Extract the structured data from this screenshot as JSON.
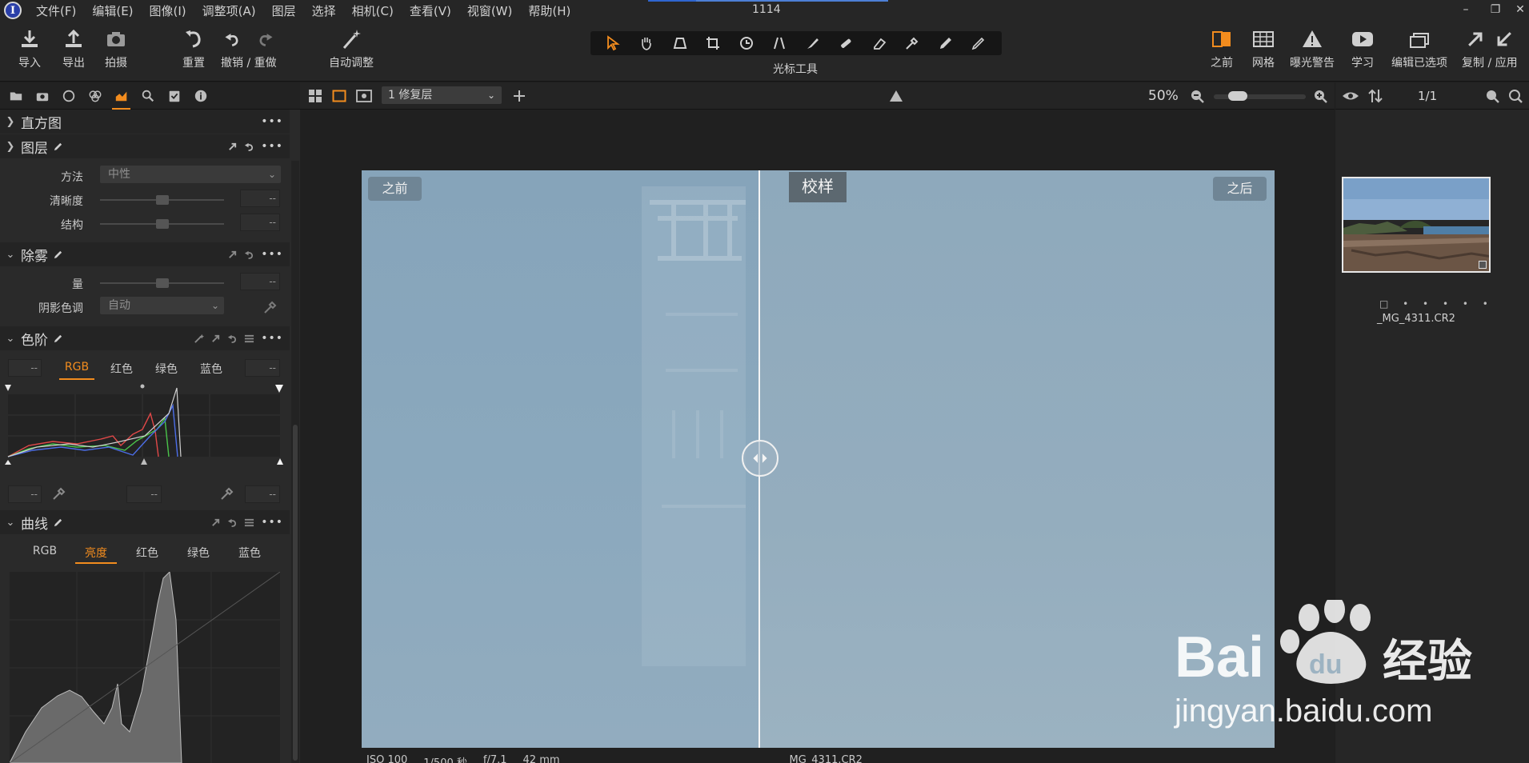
{
  "menubar": {
    "logo": "I",
    "items": [
      "文件(F)",
      "编辑(E)",
      "图像(I)",
      "调整项(A)",
      "图层",
      "选择",
      "相机(C)",
      "查看(V)",
      "视窗(W)",
      "帮助(H)"
    ],
    "window_title": "1114",
    "controls": [
      "minimize-icon",
      "restore-icon",
      "close-icon"
    ]
  },
  "toolbar": {
    "import": "导入",
    "export": "导出",
    "capture": "拍摄",
    "reset": "重置",
    "undo_redo": "撤销 / 重做",
    "auto_adjust": "自动调整",
    "cursor_tools": "光标工具",
    "before": "之前",
    "grid": "网格",
    "exposure_warning": "曝光警告",
    "learn": "学习",
    "edit_selected": "编辑已选项",
    "copy_apply": "复制 / 应用",
    "accent": "#f28c1e"
  },
  "left_panel": {
    "histogram": {
      "title": "直方图"
    },
    "layers": {
      "title": "图层"
    },
    "clarity": {
      "method_label": "方法",
      "method_value": "中性",
      "clarity_label": "清晰度",
      "clarity_value": "--",
      "structure_label": "结构",
      "structure_value": "--"
    },
    "dehaze": {
      "title": "除雾",
      "amount_label": "量",
      "amount_value": "--",
      "shadow_tone_label": "阴影色调",
      "shadow_tone_value": "自动"
    },
    "levels": {
      "title": "色阶",
      "left_value": "--",
      "right_value": "--",
      "tabs": [
        "RGB",
        "红色",
        "绿色",
        "蓝色"
      ],
      "active_tab": "RGB",
      "bottom_left_value": "--",
      "bottom_mid_value": "--",
      "bottom_right_value": "--"
    },
    "curves": {
      "title": "曲线",
      "tabs": [
        "RGB",
        "亮度",
        "红色",
        "绿色",
        "蓝色"
      ],
      "active_tab": "亮度"
    }
  },
  "viewer": {
    "layer_select": "1 修复层",
    "zoom": "50%",
    "before_badge": "之前",
    "after_badge": "之后",
    "proof_badge": "校样",
    "info": {
      "iso": "ISO 100",
      "shutter": "1/500 秒",
      "aperture": "f/7.1",
      "focal": "42 mm"
    },
    "filename": "_MG_4311.CR2"
  },
  "browser": {
    "page_count": "1/1",
    "thumb_caption": "_MG_4311.CR2",
    "rating_dots": "□ • • • • •"
  },
  "watermark": {
    "brand": "Bai",
    "brand_tail": "du",
    "brand_cn": "经验",
    "url": "jingyan.baidu.com"
  }
}
